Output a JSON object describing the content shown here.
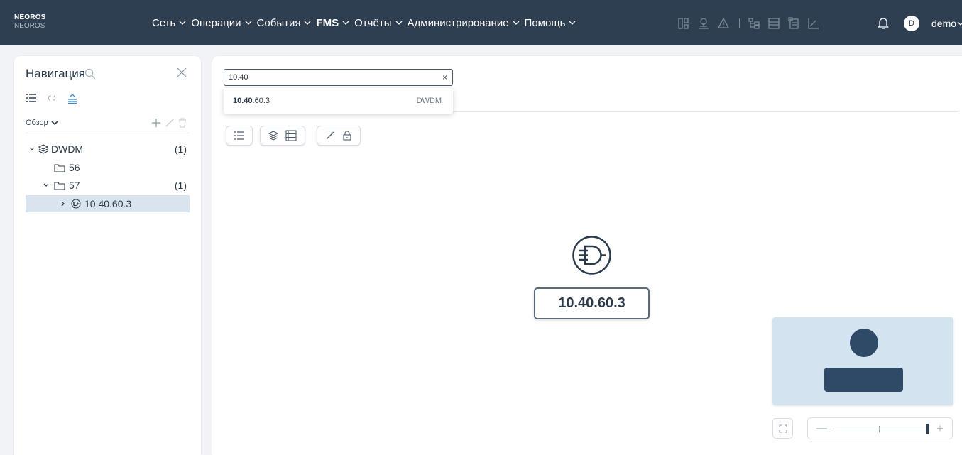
{
  "brand": {
    "name": "NEOROS",
    "sub": "NEOROS"
  },
  "menu": [
    {
      "label": "Сеть",
      "bold": false
    },
    {
      "label": "Операции",
      "bold": false
    },
    {
      "label": "События",
      "bold": false
    },
    {
      "label": "FMS",
      "bold": true
    },
    {
      "label": "Отчёты",
      "bold": false
    },
    {
      "label": "Администрирование",
      "bold": false
    },
    {
      "label": "Помощь",
      "bold": false
    }
  ],
  "user": {
    "initial": "D",
    "name": "demo"
  },
  "nav": {
    "title": "Навигация",
    "overview_label": "Обзор",
    "tree": [
      {
        "label": "DWDM",
        "count": "(1)",
        "icon": "layers-icon",
        "expanded": true
      },
      {
        "label": "56",
        "count": "",
        "icon": "folder-icon",
        "expanded": false
      },
      {
        "label": "57",
        "count": "(1)",
        "icon": "folder-icon",
        "expanded": true
      },
      {
        "label": "10.40.60.3",
        "count": "",
        "icon": "device-icon",
        "expanded": false,
        "selected": true
      }
    ]
  },
  "search": {
    "value": "10.40",
    "clear": "×",
    "result": {
      "match": "10.40",
      "rest": ".60.3",
      "type": "DWDM"
    }
  },
  "canvas": {
    "node_label": "10.40.60.3"
  },
  "colors": {
    "topbar": "#2f3f52",
    "selected": "#d9e4ef",
    "minimap_bg": "#d3e3f0",
    "minimap_shape": "#2f4a66"
  }
}
